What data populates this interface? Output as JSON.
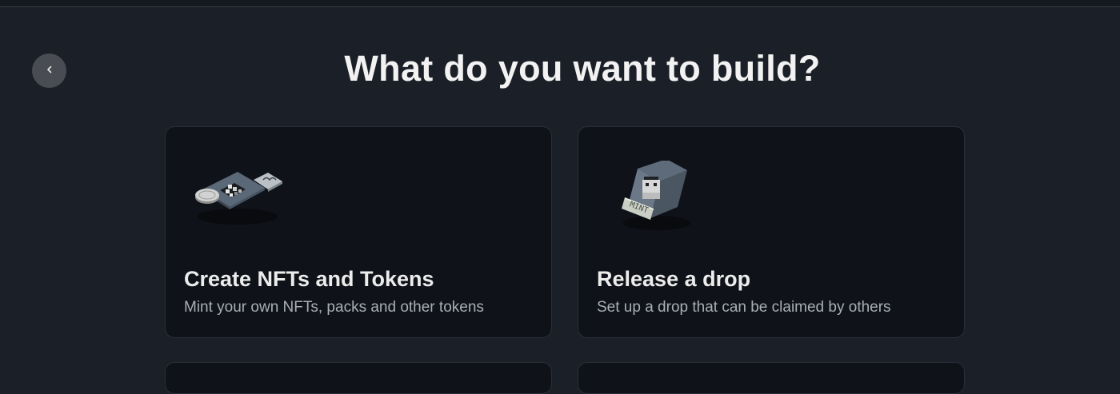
{
  "page": {
    "title": "What do you want to build?",
    "back_icon": "chevron-left-icon"
  },
  "cards": [
    {
      "title": "Create NFTs and Tokens",
      "description": "Mint your own NFTs, packs and other tokens",
      "illustration": "nft-tokens-illustration"
    },
    {
      "title": "Release a drop",
      "description": "Set up a drop that can be claimed by others",
      "illustration": "mint-drop-illustration",
      "illustration_text": "MINT"
    }
  ],
  "colors": {
    "background": "#1b1f27",
    "card_background": "#0f1218",
    "title_text": "#f2f2f2",
    "description_text": "#a9adb6",
    "back_button": "#4a4c53"
  }
}
